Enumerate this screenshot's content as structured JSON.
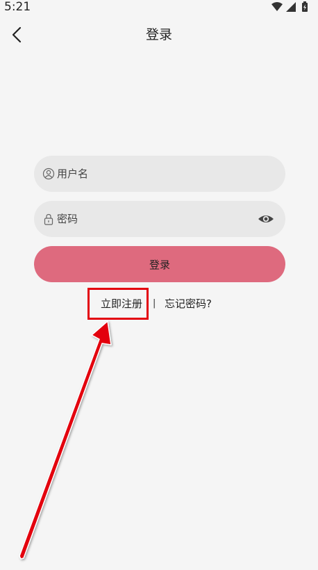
{
  "status_bar": {
    "time": "5:21",
    "icons": [
      "wifi-icon",
      "signal-icon",
      "battery-icon"
    ]
  },
  "header": {
    "back_icon": "chevron-left-icon",
    "title": "登录"
  },
  "form": {
    "username": {
      "icon": "user-icon",
      "placeholder": "用户名",
      "value": ""
    },
    "password": {
      "icon": "lock-icon",
      "placeholder": "密码",
      "value": "",
      "toggle_icon": "eye-icon"
    },
    "login_label": "登录"
  },
  "links": {
    "register": "立即注册",
    "divider": "|",
    "forgot": "忘记密码?"
  },
  "colors": {
    "background": "#f5f5f5",
    "field_bg": "#e8e8e8",
    "accent": "#de6a7e",
    "annotation": "#e3000f"
  }
}
